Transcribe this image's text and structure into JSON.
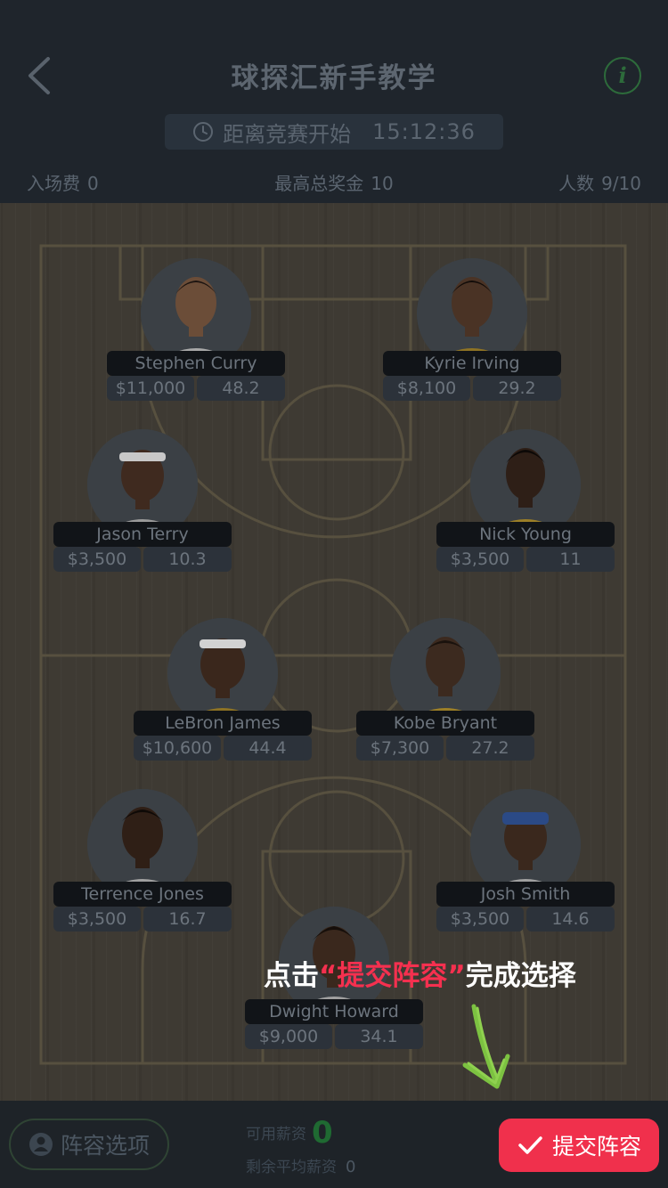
{
  "header": {
    "title": "球探汇新手教学",
    "info_icon_glyph": "i",
    "countdown_label": "距离竞赛开始",
    "countdown_time": "15:12:36",
    "entry_fee_label": "入场费",
    "entry_fee_value": "0",
    "max_prize_label": "最高总奖金",
    "max_prize_value": "10",
    "players_label": "人数",
    "players_value": "9/10"
  },
  "players": [
    {
      "name": "Stephen Curry",
      "salary": "$11,000",
      "points": "48.2",
      "jersey": "#d9d9d9"
    },
    {
      "name": "Kyrie Irving",
      "salary": "$8,100",
      "points": "29.2",
      "jersey": "#b8952a"
    },
    {
      "name": "Jason Terry",
      "salary": "$3,500",
      "points": "10.3",
      "jersey": "#c9c9c9"
    },
    {
      "name": "Nick Young",
      "salary": "$3,500",
      "points": "11",
      "jersey": "#c6a131"
    },
    {
      "name": "LeBron James",
      "salary": "$10,600",
      "points": "44.4",
      "jersey": "#b8952a"
    },
    {
      "name": "Kobe Bryant",
      "salary": "$7,300",
      "points": "27.2",
      "jersey": "#c6a131"
    },
    {
      "name": "Terrence Jones",
      "salary": "$3,500",
      "points": "16.7",
      "jersey": "#c9c9c9"
    },
    {
      "name": "Josh Smith",
      "salary": "$3,500",
      "points": "14.6",
      "jersey": "#c9c9c9"
    },
    {
      "name": "Dwight Howard",
      "salary": "$9,000",
      "points": "34.1",
      "jersey": "#c9c9c9"
    }
  ],
  "hint": {
    "prefix": "点击",
    "highlight": "“提交阵容”",
    "suffix": "完成选择"
  },
  "bottom_bar": {
    "lineup_options_label": "阵容选项",
    "available_salary_label": "可用薪资",
    "available_salary_value": "0",
    "avg_salary_label": "剩余平均薪资",
    "avg_salary_value": "0",
    "submit_label": "提交阵容"
  },
  "colors": {
    "accent": "#f0304c",
    "positive": "#1f6a32",
    "hint_arrow": "#7cc241"
  },
  "icons": {
    "back": "chevron-left-icon",
    "info": "info-icon",
    "clock": "clock-icon",
    "lineup": "person-icon",
    "submit": "check-icon",
    "hint": "hand-drawn-arrow-icon"
  }
}
